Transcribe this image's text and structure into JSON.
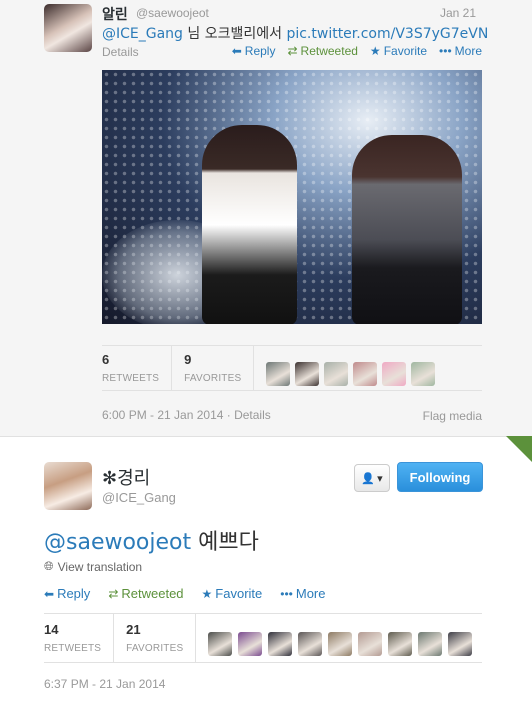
{
  "tweet1": {
    "name": "알린",
    "handle": "@saewoojeot",
    "date": "Jan 21",
    "mention": "@ICE_Gang",
    "text_middle": " 님 오크밸리에서 ",
    "link": "pic.twitter.com/V3S7yG7eVN",
    "details": "Details",
    "actions": {
      "reply": "Reply",
      "retweeted": "Retweeted",
      "favorite": "Favorite",
      "more": "More"
    },
    "retweets_count": "6",
    "retweets_label": "RETWEETS",
    "favorites_count": "9",
    "favorites_label": "FAVORITES",
    "timestamp": "6:00 PM - 21 Jan 2014 · Details",
    "flag_media": "Flag media",
    "favoriter_colors": [
      "#6d7775",
      "#3b3130",
      "#a7b0a8",
      "#c08a8c",
      "#f0a9c4",
      "#9fb7a0"
    ]
  },
  "tweet2": {
    "name": "✻경리",
    "handle": "@ICE_Gang",
    "follow_button": "Following",
    "user_menu_icon": "▾",
    "mention": "@saewoojeot",
    "text": " 예쁘다",
    "view_translation": "View translation",
    "actions": {
      "reply": "Reply",
      "retweeted": "Retweeted",
      "favorite": "Favorite",
      "more": "More"
    },
    "retweets_count": "14",
    "retweets_label": "RETWEETS",
    "favorites_count": "21",
    "favorites_label": "FAVORITES",
    "timestamp": "6:37 PM - 21 Jan 2014",
    "favoriter_colors": [
      "#4b4d4a",
      "#7a4a8f",
      "#2f2f3a",
      "#5a5555",
      "#8d7a63",
      "#b39a92",
      "#5e5b4e",
      "#6b7870",
      "#3d3d46"
    ]
  },
  "colors": {
    "link": "#2b7bb9",
    "retweeted": "#5c913b",
    "follow_button": "#2a8fdb"
  }
}
